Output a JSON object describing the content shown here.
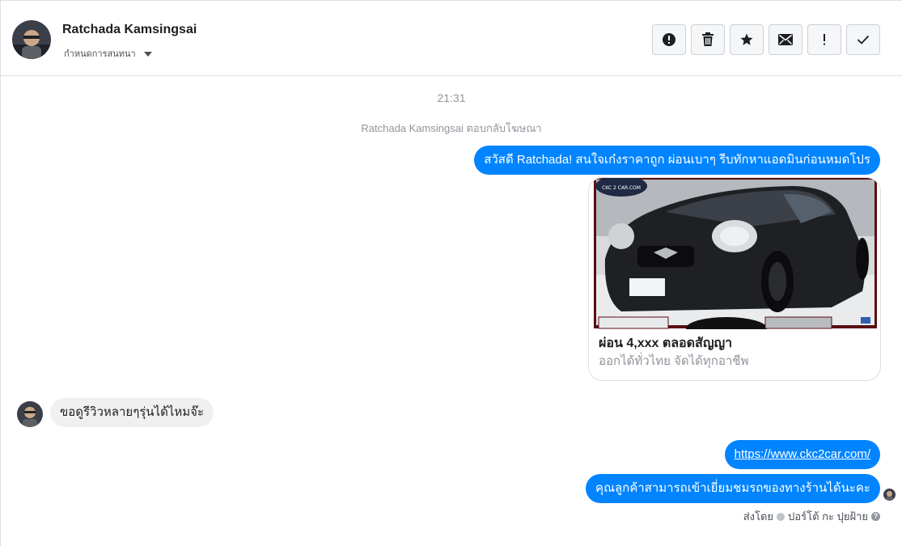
{
  "header": {
    "contact_name": "Ratchada Kamsingsai",
    "assign_label": "กำหนดการสนทนา",
    "actions": [
      {
        "name": "mark-spam-button",
        "icon": "alert-circle-icon"
      },
      {
        "name": "delete-button",
        "icon": "trash-icon"
      },
      {
        "name": "star-button",
        "icon": "star-icon"
      },
      {
        "name": "mark-unread-button",
        "icon": "envelope-icon"
      },
      {
        "name": "follow-up-button",
        "icon": "exclamation-icon"
      },
      {
        "name": "mark-done-button",
        "icon": "checkmark-icon"
      }
    ]
  },
  "thread": {
    "timestamp": "21:31",
    "reply_note": "Ratchada Kamsingsai ตอบกลับโฆษณา",
    "greeting_message": "สวัสดี Ratchada! สนใจเก๋งราคาถูก ผ่อนเบาๆ รีบทักหาแอดมินก่อนหมดโปร",
    "ad_card": {
      "logo_text": "CKC 2 CAR.COM",
      "title": "ผ่อน 4,xxx ตลอดสัญญา",
      "subtitle": "ออกได้ทั่วไทย จัดได้ทุกอาชีพ"
    },
    "customer_message": "ขอดูรีวิวหลายๆรุ่นได้ไหมจ๊ะ",
    "link_message": "https://www.ckc2car.com/",
    "visit_message": "คุณลูกค้าสามารถเข้าเยี่ยมชมรถของทางร้านได้นะคะ",
    "sent_by_prefix": "ส่งโดย",
    "sent_by_name": "ปอร์โต้ กะ ปุยฝ้าย",
    "help_glyph": "?"
  },
  "colors": {
    "accent": "#0084ff",
    "incoming_bubble": "#f1f0f0",
    "muted_text": "#90949c",
    "border": "#dddfe2"
  }
}
